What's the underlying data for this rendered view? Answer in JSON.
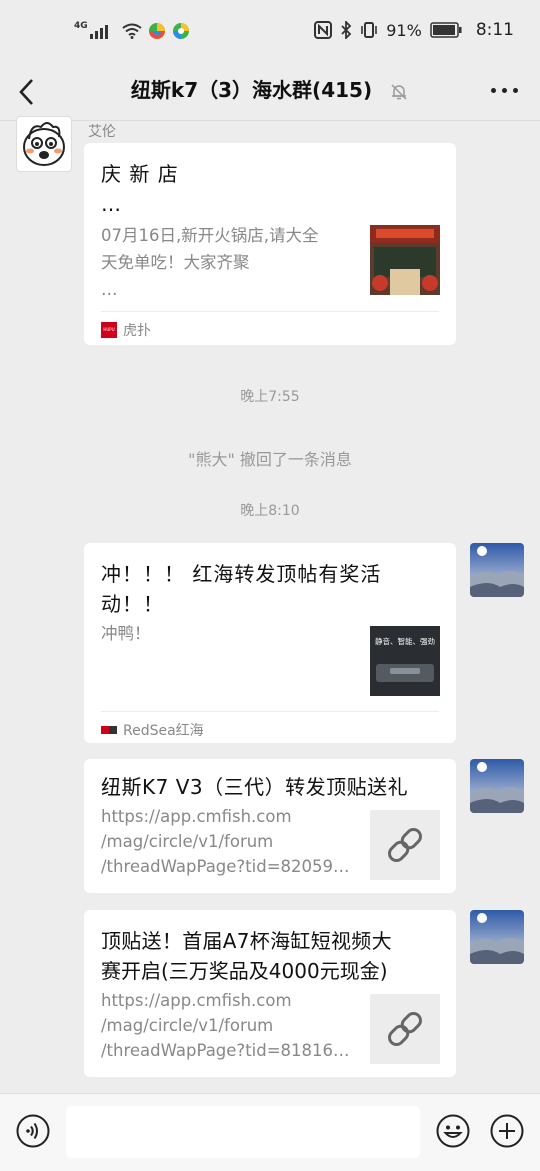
{
  "status_bar": {
    "network": "4G",
    "battery_pct": "91%",
    "time": "8:11"
  },
  "header": {
    "title": "纽斯k7（3）海水群(415)"
  },
  "messages": [
    {
      "sender": "艾伦",
      "title": "庆 新 店",
      "title_more": "…",
      "desc": [
        "07月16日,新开火锅店,请大全",
        "天免单吃！大家齐聚",
        "…"
      ],
      "source": "虎扑",
      "source_logo": "HUPU"
    },
    {
      "title": [
        "冲！！！ 红海转发顶帖有奖活",
        "动！！"
      ],
      "desc": [
        "冲鸭！"
      ],
      "thumb_text": "静音、智能、强劲",
      "source": "RedSea红海"
    },
    {
      "title": [
        "纽斯K7 V3（三代）转发顶贴送礼"
      ],
      "desc": [
        "https://app.cmfish.com",
        "/mag/circle/v1/forum",
        "/threadWapPage?tid=82059…"
      ]
    },
    {
      "title": [
        "顶贴送！首届A7杯海缸短视频大",
        "赛开启(三万奖品及4000元现金)"
      ],
      "desc": [
        "https://app.cmfish.com",
        "/mag/circle/v1/forum",
        "/threadWapPage?tid=81816…"
      ]
    }
  ],
  "timestamps": {
    "t1": "晚上7:55",
    "t2": "晚上8:10"
  },
  "system": {
    "recall": "\"熊大\" 撤回了一条消息"
  },
  "colors": {
    "bg": "#ededed",
    "card": "#ffffff",
    "muted": "#888888",
    "hupu_red": "#d0021b"
  }
}
